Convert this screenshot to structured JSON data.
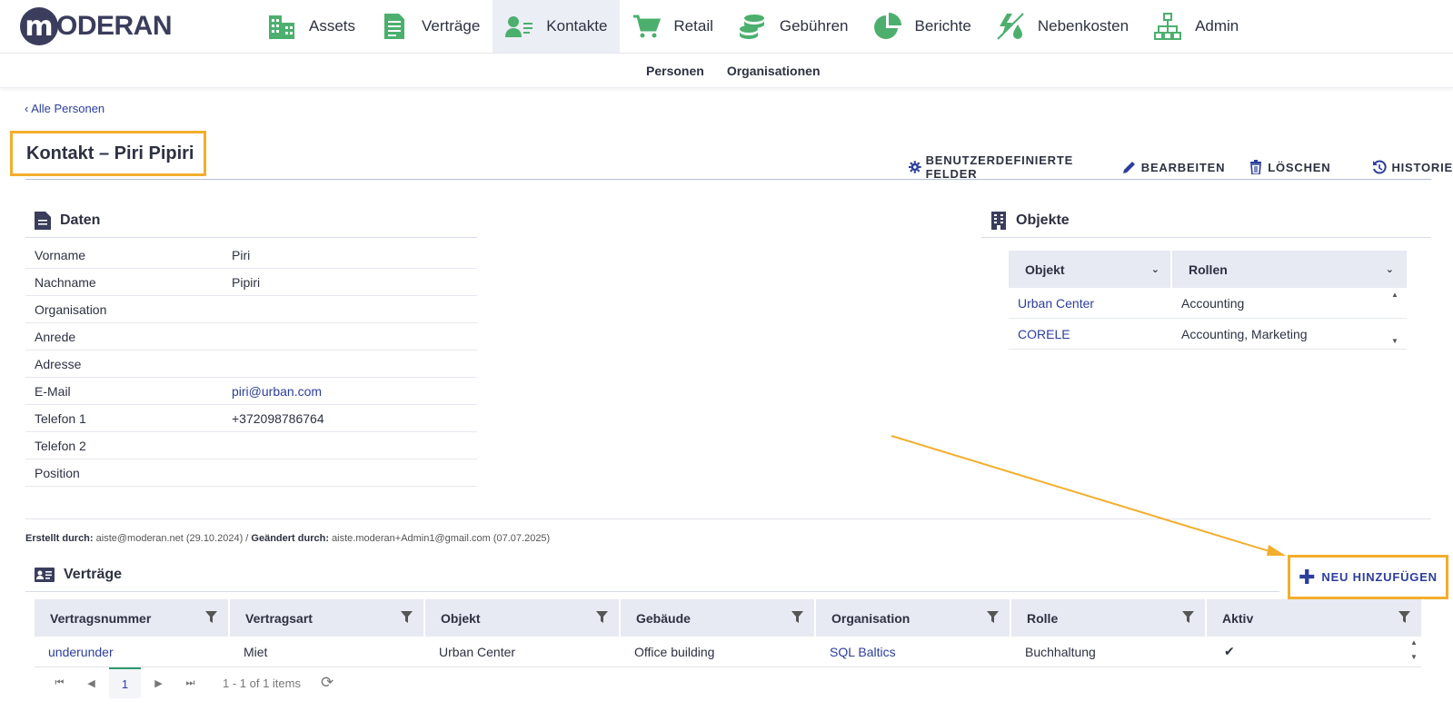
{
  "brand": {
    "logo_letter": "m",
    "logo_text": "ODERAN"
  },
  "nav": {
    "items": [
      {
        "label": "Assets",
        "icon": "building-icon"
      },
      {
        "label": "Verträge",
        "icon": "document-icon"
      },
      {
        "label": "Kontakte",
        "icon": "contact-card-icon",
        "active": true
      },
      {
        "label": "Retail",
        "icon": "cart-icon"
      },
      {
        "label": "Gebühren",
        "icon": "coins-icon"
      },
      {
        "label": "Berichte",
        "icon": "pie-chart-icon"
      },
      {
        "label": "Nebenkosten",
        "icon": "utilities-icon"
      },
      {
        "label": "Admin",
        "icon": "org-chart-icon"
      }
    ]
  },
  "subnav": {
    "items": [
      "Personen",
      "Organisationen"
    ]
  },
  "back_link": "‹ Alle Personen",
  "page_title": "Kontakt – Piri Pipiri",
  "actions": {
    "custom_fields": "BENUTZERDEFINIERTE FELDER",
    "edit": "BEARBEITEN",
    "delete": "LÖSCHEN",
    "history": "HISTORIE"
  },
  "daten": {
    "title": "Daten",
    "rows": [
      {
        "label": "Vorname",
        "value": "Piri"
      },
      {
        "label": "Nachname",
        "value": "Pipiri"
      },
      {
        "label": "Organisation",
        "value": ""
      },
      {
        "label": "Anrede",
        "value": ""
      },
      {
        "label": "Adresse",
        "value": ""
      },
      {
        "label": "E-Mail",
        "value": "piri@urban.com"
      },
      {
        "label": "Telefon 1",
        "value": "+372098786764"
      },
      {
        "label": "Telefon 2",
        "value": ""
      },
      {
        "label": "Position",
        "value": ""
      }
    ]
  },
  "objekte": {
    "title": "Objekte",
    "columns": [
      "Objekt",
      "Rollen"
    ],
    "rows": [
      {
        "objekt": "Urban Center",
        "rollen": "Accounting"
      },
      {
        "objekt": "CORELE",
        "rollen": "Accounting, Marketing"
      }
    ]
  },
  "meta": {
    "created_label": "Erstellt durch:",
    "created_value": "aiste@moderan.net (29.10.2024)",
    "sep": " / ",
    "changed_label": "Geändert durch:",
    "changed_value": "aiste.moderan+Admin1@gmail.com (07.07.2025)"
  },
  "vertraege": {
    "title": "Verträge",
    "add_label": "NEU HINZUFÜGEN",
    "columns": [
      "Vertragsnummer",
      "Vertragsart",
      "Objekt",
      "Gebäude",
      "Organisation",
      "Rolle",
      "Aktiv"
    ],
    "rows": [
      {
        "nummer": "underunder",
        "art": "Miet",
        "objekt": "Urban Center",
        "gebaeude": "Office building",
        "organisation": "SQL Baltics",
        "rolle": "Buchhaltung",
        "aktiv": "✔"
      }
    ]
  },
  "pager": {
    "current": "1",
    "info": "1 - 1 of 1 items"
  },
  "colors": {
    "accent_green": "#4caf6e",
    "link_blue": "#2c3e9c",
    "highlight_orange": "#f2ae2c",
    "header_bg": "#e7e9f3"
  }
}
